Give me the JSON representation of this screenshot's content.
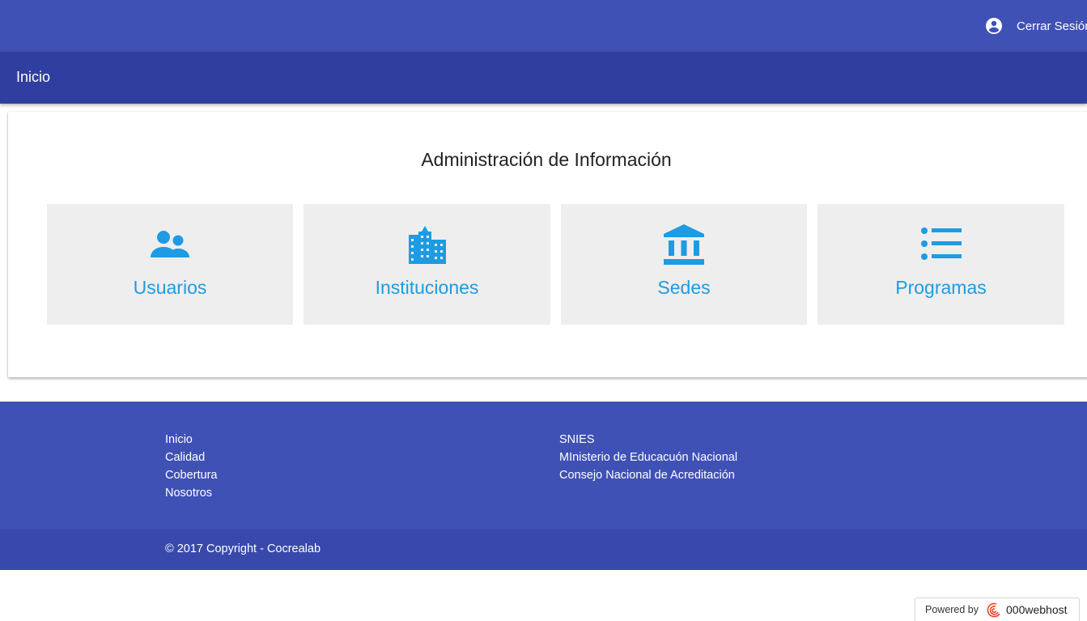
{
  "header": {
    "logout_label": "Cerrar Sesión",
    "logout_icon": "account-circle-icon"
  },
  "subheader": {
    "title": "Inicio"
  },
  "main": {
    "title": "Administración de Información",
    "tiles": [
      {
        "label": "Usuarios",
        "icon": "people-icon"
      },
      {
        "label": "Instituciones",
        "icon": "building-icon"
      },
      {
        "label": "Sedes",
        "icon": "bank-icon"
      },
      {
        "label": "Programas",
        "icon": "list-icon"
      }
    ]
  },
  "footer": {
    "links_left": [
      "Inicio",
      "Calidad",
      "Cobertura",
      "Nosotros"
    ],
    "links_right": [
      "SNIES",
      "MInisterio de Educacuón Nacional",
      "Consejo Nacional de Acreditación"
    ],
    "copyright": "© 2017 Copyright - Cocrealab"
  },
  "badge": {
    "prefix": "Powered by",
    "brand": "000webhost"
  },
  "colors": {
    "primary": "#3f51b5",
    "primary_dark": "#303f9f",
    "copyright_bar": "#3949ab",
    "accent": "#1e9be3",
    "tile_bg": "#eeeeee"
  }
}
